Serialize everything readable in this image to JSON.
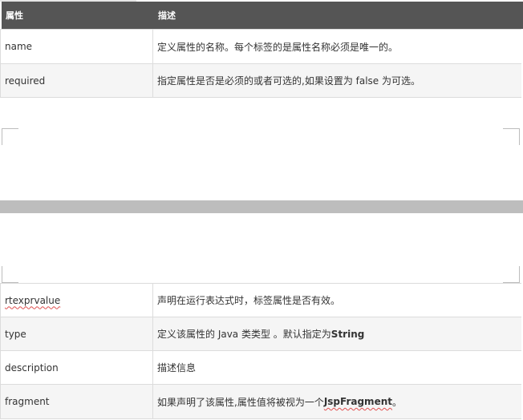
{
  "table1": {
    "headers": [
      "属性",
      "描述"
    ],
    "rows": [
      {
        "attr": "name",
        "desc": "定义属性的名称。每个标签的是属性名称必须是唯一的。"
      },
      {
        "attr": "required",
        "desc": "指定属性是否是必须的或者可选的,如果设置为 false 为可选。"
      }
    ]
  },
  "table2": {
    "rows": [
      {
        "attr": "rtexprvalue",
        "desc": "声明在运行表达式时，标签属性是否有效。"
      },
      {
        "attr": "type",
        "desc_prefix": "定义该属性的 Java 类类型 。默认指定为 ",
        "desc_bold": "String",
        "desc_suffix": ""
      },
      {
        "attr": "description",
        "desc": "描述信息"
      },
      {
        "attr": "fragment",
        "desc_prefix": "如果声明了该属性,属性值将被视为一个 ",
        "desc_bold": "JspFragment",
        "desc_suffix": "。"
      }
    ]
  },
  "colors": {
    "header_bg": "#555555",
    "row_alt": "#f5f5f5",
    "band": "#bdbdbd",
    "spell_underline": "#e05050"
  }
}
